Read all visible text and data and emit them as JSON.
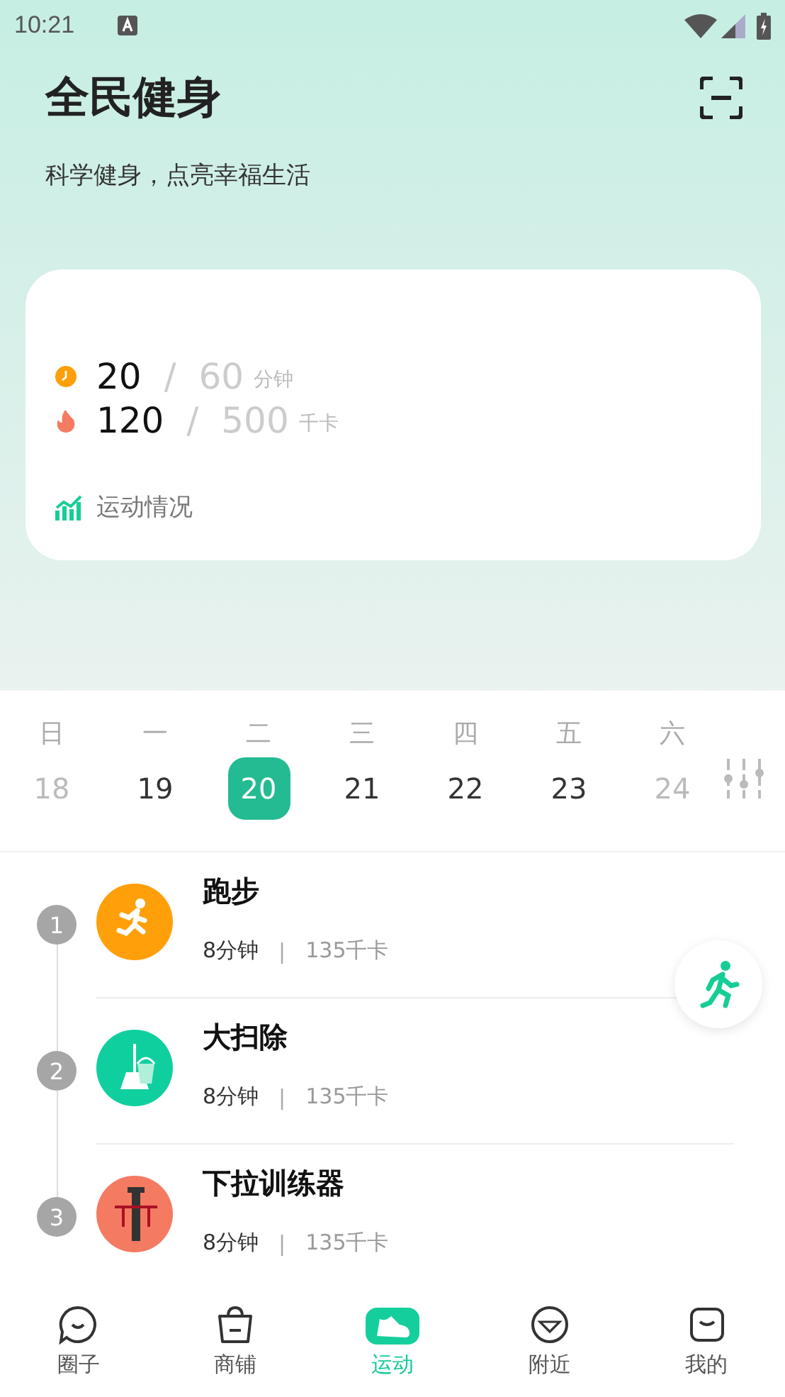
{
  "status_bar": {
    "time": "10:21"
  },
  "header": {
    "title": "全民健身",
    "subtitle": "科学健身，点亮幸福生活"
  },
  "summary": {
    "stats": [
      {
        "kind": "time",
        "value": "20",
        "separator": "/",
        "goal": "60",
        "unit": "分钟"
      },
      {
        "kind": "calories",
        "value": "120",
        "separator": "/",
        "goal": "500",
        "unit": "千卡"
      }
    ],
    "link": "运动情况"
  },
  "calendar": {
    "days": [
      {
        "weekday": "日",
        "date": "18",
        "selected": false,
        "disabled": true
      },
      {
        "weekday": "一",
        "date": "19",
        "selected": false,
        "disabled": false
      },
      {
        "weekday": "二",
        "date": "20",
        "selected": true,
        "disabled": false
      },
      {
        "weekday": "三",
        "date": "21",
        "selected": false,
        "disabled": false
      },
      {
        "weekday": "四",
        "date": "22",
        "selected": false,
        "disabled": false
      },
      {
        "weekday": "五",
        "date": "23",
        "selected": false,
        "disabled": false
      },
      {
        "weekday": "六",
        "date": "24",
        "selected": false,
        "disabled": true
      }
    ]
  },
  "activities": [
    {
      "index": "1",
      "name": "跑步",
      "duration": "8分钟",
      "separator": "|",
      "calories": "135千卡",
      "kind": "running",
      "color": "#ff9f0a"
    },
    {
      "index": "2",
      "name": "大扫除",
      "duration": "8分钟",
      "separator": "|",
      "calories": "135千卡",
      "kind": "cleaning",
      "color": "#10cf9f"
    },
    {
      "index": "3",
      "name": "下拉训练器",
      "duration": "8分钟",
      "separator": "|",
      "calories": "135千卡",
      "kind": "machine",
      "color": "#f47a62"
    }
  ],
  "nav": [
    {
      "label": "圈子",
      "kind": "chat",
      "selected": false
    },
    {
      "label": "商铺",
      "kind": "bag",
      "selected": false
    },
    {
      "label": "运动",
      "kind": "shoe",
      "selected": true
    },
    {
      "label": "附近",
      "kind": "compass",
      "selected": false
    },
    {
      "label": "我的",
      "kind": "profile",
      "selected": false
    }
  ]
}
